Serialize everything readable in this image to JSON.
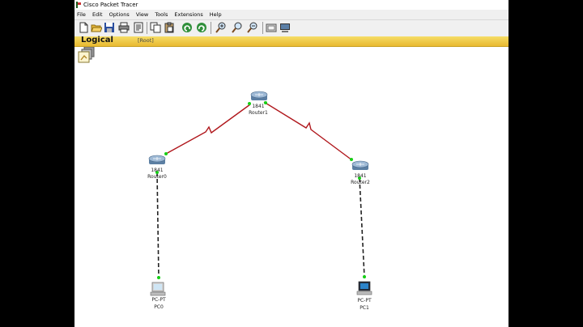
{
  "window": {
    "title": "Cisco Packet Tracer"
  },
  "menu": [
    "File",
    "Edit",
    "Options",
    "View",
    "Tools",
    "Extensions",
    "Help"
  ],
  "toolbar": [
    "new-icon",
    "open-icon",
    "save-icon",
    "print-icon",
    "activity-wizard-icon",
    "copy-icon",
    "paste-icon",
    "undo-icon",
    "redo-icon",
    "zoom-in-icon",
    "zoom-reset-icon",
    "zoom-out-icon",
    "palette-icon",
    "custom-device-icon"
  ],
  "workspace": {
    "mode_label": "Logical",
    "path_label": "[Root]"
  },
  "devices": {
    "router1": {
      "model": "1841",
      "name": "Router1"
    },
    "router0": {
      "model": "1841",
      "name": "Router0"
    },
    "router2": {
      "model": "1841",
      "name": "Router2"
    },
    "pc0": {
      "model": "PC-PT",
      "name": "PC0"
    },
    "pc1": {
      "model": "PC-PT",
      "name": "PC1"
    }
  },
  "colors": {
    "serial_link": "#b0171c",
    "ethernet_link": "#222222",
    "link_up": "#16d016",
    "logical_bar": "#f0c64a"
  }
}
